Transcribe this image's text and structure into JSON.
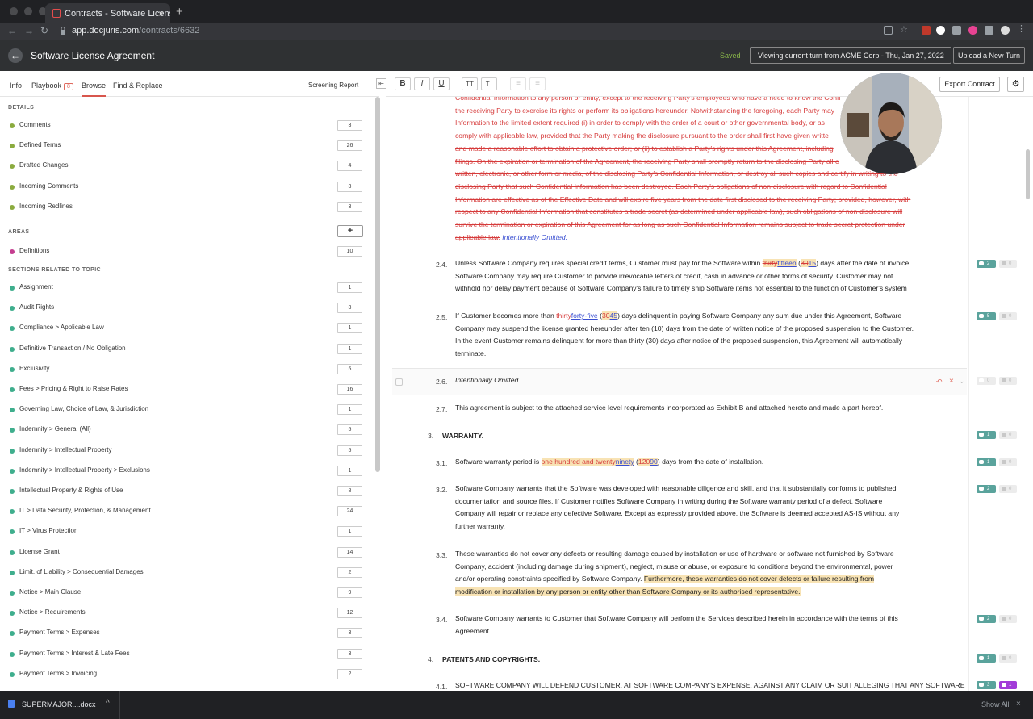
{
  "browser": {
    "tab_title": "Contracts - Software License A",
    "tab_close": "×",
    "new_tab": "+",
    "url_domain": "app.docjuris.com",
    "url_path": "/contracts/6632",
    "back_glyph": "←",
    "forward_glyph": "→",
    "reload_glyph": "↻"
  },
  "app": {
    "title": "Software License Agreement",
    "back_glyph": "←",
    "saved_label": "Saved",
    "turn_selector": "Viewing current turn from ACME Corp - Thu, Jan 27, 2022",
    "upload_label": "Upload a New Turn",
    "export_label": "Export Contract",
    "gear_glyph": "⚙",
    "accent_color": "#d8564d"
  },
  "leftnav": {
    "tabs": [
      "Info",
      "Playbook",
      "Browse",
      "Find & Replace"
    ],
    "playbook_badge": "8",
    "active_tab": "Browse",
    "screening_label": "Screening Report",
    "collapse_glyph": "⇤"
  },
  "details": {
    "heading": "DETAILS",
    "items": [
      {
        "label": "Comments",
        "count": "3",
        "color": "#8bab3f"
      },
      {
        "label": "Defined Terms",
        "count": "26",
        "color": "#8bab3f"
      },
      {
        "label": "Drafted Changes",
        "count": "4",
        "color": "#8bab3f"
      },
      {
        "label": "Incoming Comments",
        "count": "3",
        "color": "#8bab3f"
      },
      {
        "label": "Incoming Redlines",
        "count": "3",
        "color": "#8bab3f"
      }
    ]
  },
  "areas": {
    "heading": "AREAS",
    "add_glyph": "+",
    "items": [
      {
        "label": "Definitions",
        "count": "10",
        "color": "#c43d8f"
      }
    ]
  },
  "topics": {
    "heading": "SECTIONS RELATED TO TOPIC",
    "items": [
      {
        "label": "Assignment",
        "count": "1"
      },
      {
        "label": "Audit Rights",
        "count": "3"
      },
      {
        "label": "Compliance > Applicable Law",
        "count": "1"
      },
      {
        "label": "Definitive Transaction / No Obligation",
        "count": "1"
      },
      {
        "label": "Exclusivity",
        "count": "5"
      },
      {
        "label": "Fees > Pricing & Right to Raise Rates",
        "count": "16"
      },
      {
        "label": "Governing Law, Choice of Law, & Jurisdiction",
        "count": "1"
      },
      {
        "label": "Indemnity > General (All)",
        "count": "5"
      },
      {
        "label": "Indemnity > Intellectual Property",
        "count": "5"
      },
      {
        "label": "Indemnity > Intellectual Property > Exclusions",
        "count": "1"
      },
      {
        "label": "Intellectual Property & Rights of Use",
        "count": "8"
      },
      {
        "label": "IT > Data Security, Protection, & Management",
        "count": "24"
      },
      {
        "label": "IT > Virus Protection",
        "count": "1"
      },
      {
        "label": "License Grant",
        "count": "14"
      },
      {
        "label": "Limit. of Liability > Consequential Damages",
        "count": "2"
      },
      {
        "label": "Notice > Main Clause",
        "count": "9"
      },
      {
        "label": "Notice > Requirements",
        "count": "12"
      },
      {
        "label": "Payment Terms > Expenses",
        "count": "3"
      },
      {
        "label": "Payment Terms > Interest & Late Fees",
        "count": "3"
      },
      {
        "label": "Payment Terms > Invoicing",
        "count": "2"
      }
    ],
    "color": "#3fae8d"
  },
  "toolbar": {
    "bold": "B",
    "italic": "I",
    "underline": "U",
    "caps": "TT",
    "smallcaps": "Tт",
    "left": "≡",
    "right": "≡"
  },
  "document": {
    "red_block": [
      "Confidential Information to any person or entity, except to the receiving Party's employees who have a need to know the Confi",
      "the receiving Party to exercise its rights or perform its obligations hereunder. Notwithstanding the foregoing, each Party may",
      "Information to the limited extent required (i) in order to comply with the order of a court or other governmental body, or as",
      "comply with applicable law, provided that the Party making the disclosure pursuant to the order shall first have given writte",
      "and made a reasonable effort to obtain a protective order; or (ii) to establish a Party's rights under this Agreement, including",
      "filings. On the expiration or termination of the Agreement, the receiving Party shall promptly return to the disclosing Party all c",
      "written, electronic, or other form or media, of the disclosing Party's Confidential Information, or destroy all such copies and certify in writing to the",
      "disclosing Party that such Confidential Information has been destroyed. Each Party's obligations of non-disclosure with regard to Confidential",
      "Information are effective as of the Effective Date and will expire five years from the date first disclosed to the receiving Party; provided, however, with",
      "respect to any Confidential Information that constitutes a trade secret (as determined under applicable law), such obligations of non-disclosure will",
      "survive the termination or expiration of this Agreement for as long as such Confidential Information remains subject to trade secret protection under"
    ],
    "red_block_last": "applicable law.",
    "intentionally_omitted": "Intentionally Omitted.",
    "s24": {
      "num": "2.4.",
      "a": "Unless Software Company requires special credit terms, Customer must pay for the Software within ",
      "del1": "thirty",
      "ins1": "fifteen",
      "paren_open": " (",
      "del2": "30",
      "ins2": "15",
      "b": ") days after the date of invoice.",
      "line2": "Software Company may require Customer to provide irrevocable letters of credit, cash in advance or other forms of security.  Customer may not",
      "line3": "withhold nor delay payment because of Software Company's failure to timely ship Software items not essential to the function of Customer's system"
    },
    "s25": {
      "num": "2.5.",
      "a": "If Customer becomes more than ",
      "del1": "thirty",
      "ins1": "forty-five",
      "paren_open": " (",
      "del2": "30",
      "ins2": "45",
      "b": ") days delinquent in paying Software Company any sum due under this Agreement, Software",
      "line2": "Company may suspend the license granted hereunder after ten (10) days from the date of written notice of the proposed suspension to the Customer.",
      "line3": "In the event Customer remains delinquent for more than thirty (30) days after notice of the proposed suspension, this Agreement will automatically",
      "line4": "terminate."
    },
    "s26": {
      "num": "2.6.",
      "text": "Intentionally Omitted."
    },
    "s27": {
      "num": "2.7.",
      "text": "This agreement is subject to the attached service level requirements incorporated as Exhibit B and attached hereto and made a part hereof."
    },
    "s3": {
      "num": "3.",
      "text": "WARRANTY."
    },
    "s31": {
      "num": "3.1.",
      "a": "Software warranty period is ",
      "del1": "one hundred and twenty",
      "ins1": "ninety",
      "paren_open": " (",
      "del2": "120",
      "ins2": "90",
      "b": ") days from the date of installation."
    },
    "s32": {
      "num": "3.2.",
      "lines": [
        "Software Company warrants that the Software was developed with reasonable diligence and skill, and that it substantially conforms to published",
        "documentation and source files.  If Customer notifies Software Company in writing during the Software warranty period of a defect, Software",
        "Company will repair or replace any defective Software.  Except as expressly provided above, the Software is deemed accepted AS-IS without any",
        "further warranty."
      ]
    },
    "s33": {
      "num": "3.3.",
      "line1": "These warranties do not cover any defects or resulting damage caused by installation or use of hardware or software not furnished by Software",
      "line2": "Company, accident (including damage during shipment), neglect, misuse or abuse, or exposure to conditions beyond the environmental, power",
      "line3a": "and/or operating constraints specified by Software Company.  ",
      "line3del": "Furthermore, these warranties do not cover defects or      failure resulting from",
      "line4del": "modification or installation by any person or entity other than Software Company or its authorised representative."
    },
    "s34": {
      "num": "3.4.",
      "lines": [
        "Software Company warrants to Customer that Software Company will perform the Services described herein in accordance with the terms of this",
        "Agreement"
      ]
    },
    "s4": {
      "num": "4.",
      "text": "PATENTS AND COPYRIGHTS."
    },
    "s41": {
      "num": "4.1.",
      "text": "SOFTWARE COMPANY WILL DEFEND CUSTOMER, AT SOFTWARE COMPANY'S EXPENSE, AGAINST ANY CLAIM OR SUIT ALLEGING THAT ANY SOFTWARE"
    }
  },
  "margin": {
    "s24": {
      "a": "2",
      "b": "0"
    },
    "s25": {
      "a": "5",
      "b": "0"
    },
    "s26": {
      "a": "0",
      "b": "0"
    },
    "s3": {
      "a": "1",
      "b": "0"
    },
    "s31": {
      "a": "1",
      "b": "0"
    },
    "s32": {
      "a": "2",
      "b": "0"
    },
    "s34": {
      "a": "2",
      "b": "0"
    },
    "s4": {
      "a": "1",
      "b": "0"
    },
    "s41": {
      "a": "3",
      "b": "1"
    }
  },
  "downloads": {
    "file": "SUPERMAJOR....docx",
    "chevron": "^",
    "show_all": "Show All",
    "close": "×"
  }
}
